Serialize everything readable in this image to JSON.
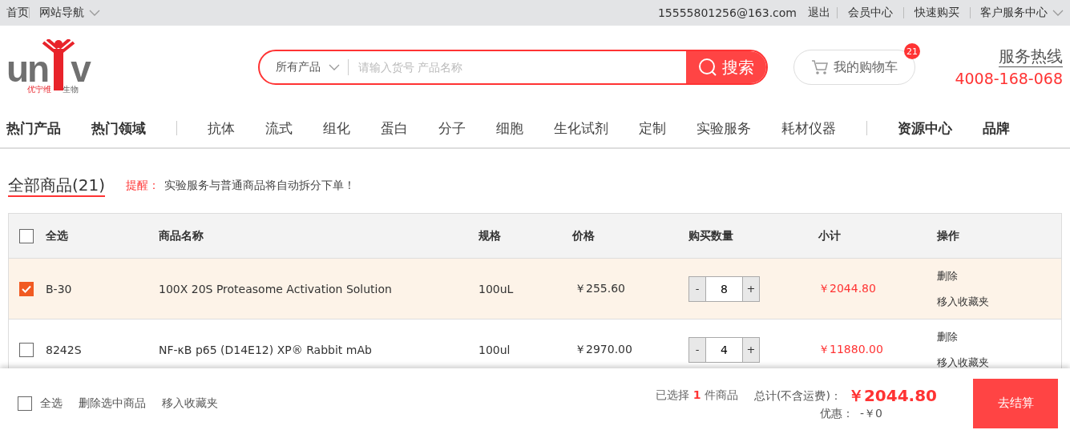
{
  "top_bar": {
    "left": [
      {
        "label": "首页",
        "dropdown": false
      },
      {
        "label": "网站导航",
        "dropdown": true
      }
    ],
    "account": "15555801256@163.com",
    "logout": "退出",
    "right": [
      {
        "label": "会员中心",
        "dropdown": false
      },
      {
        "label": "快速购买",
        "dropdown": false
      },
      {
        "label": "客户服务中心",
        "dropdown": true
      }
    ]
  },
  "logo": {
    "letters_left": "un",
    "letters_right": "v",
    "name_left": "优宁维",
    "name_right": "生物"
  },
  "search": {
    "category": "所有产品",
    "placeholder": "请输入货号 产品名称",
    "button": "搜索"
  },
  "cart": {
    "label": "我的购物车",
    "count": "21"
  },
  "hotline": {
    "title": "服务热线",
    "number": "4008-168-068"
  },
  "nav": {
    "left": [
      "热门产品",
      "热门领域"
    ],
    "middle": [
      "抗体",
      "流式",
      "组化",
      "蛋白",
      "分子",
      "细胞",
      "生化试剂",
      "定制",
      "实验服务",
      "耗材仪器"
    ],
    "right": [
      "资源中心",
      "品牌"
    ]
  },
  "section": {
    "title": "全部商品(21)",
    "notice_label": "提醒：",
    "notice": "实验服务与普通商品将自动拆分下单！"
  },
  "table": {
    "select_all": {
      "label": "全选",
      "checked": false
    },
    "columns": [
      "商品名称",
      "规格",
      "价格",
      "购买数量",
      "小计",
      "操作"
    ],
    "rows": [
      {
        "code": "B-30",
        "name": "100X 20S Proteasome Activation Solution",
        "spec": "100uL",
        "price": "￥255.60",
        "decrease": "-",
        "quantity": "8",
        "increase": "+",
        "subtotal": "￥2044.80",
        "actions": [
          "删除",
          "移入收藏夹"
        ],
        "selected": true
      },
      {
        "code": "8242S",
        "name": "NF-κB p65 (D14E12) XP® Rabbit mAb",
        "spec": "100ul",
        "price": "￥2970.00",
        "decrease": "-",
        "quantity": "4",
        "increase": "+",
        "subtotal": "￥11880.00",
        "actions": [
          "删除",
          "移入收藏夹"
        ],
        "selected": false
      }
    ]
  },
  "footer": {
    "select_all": {
      "label": "全选",
      "checked": false
    },
    "links": [
      "删除选中商品",
      "移入收藏夹"
    ],
    "selected_prefix": "已选择",
    "selected_count": "1",
    "selected_suffix": "件商品",
    "total_label": "总计(不含运费)：",
    "total": "￥2044.80",
    "discount_label": "优惠：",
    "discount": "-￥0",
    "checkout": "去结算"
  }
}
